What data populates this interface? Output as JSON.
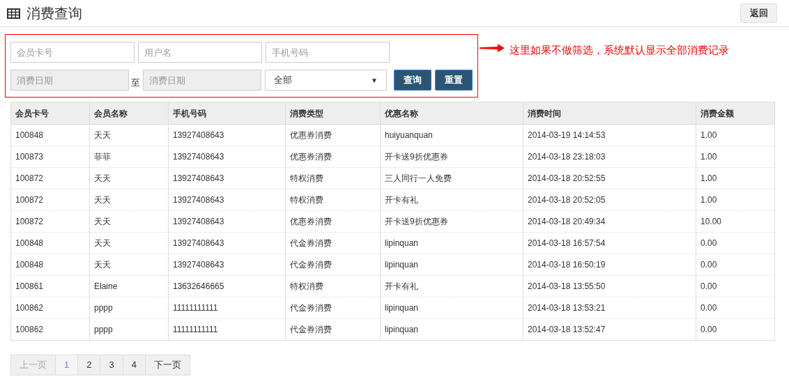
{
  "header": {
    "title": "消费查询",
    "back_button": "返回"
  },
  "filters": {
    "row_1": [
      {
        "placeholder": "会员卡号",
        "disabled": false
      },
      {
        "placeholder": "用户名",
        "disabled": false
      },
      {
        "placeholder": "手机号码",
        "disabled": false
      }
    ],
    "date_from": {
      "placeholder": "消费日期",
      "disabled": true
    },
    "date_separator": "至",
    "date_to": {
      "placeholder": "消费日期",
      "disabled": true
    },
    "type_select": {
      "value": "全部",
      "caret": "▼"
    },
    "buttons": [
      "查询",
      "重置"
    ]
  },
  "annotation": "这里如果不做筛选，系统默认显示全部消费记录",
  "table": {
    "columns": [
      "会员卡号",
      "会员名称",
      "手机号码",
      "消费类型",
      "优惠名称",
      "消费时间",
      "消费金额"
    ],
    "rows": [
      [
        "100848",
        "天天",
        "13927408643",
        "优惠券消费",
        "huiyuanquan",
        "2014-03-19 14:14:53",
        "1.00"
      ],
      [
        "100873",
        "菲菲",
        "13927408643",
        "优惠券消费",
        "开卡送9折优惠券",
        "2014-03-18 23:18:03",
        "1.00"
      ],
      [
        "100872",
        "天天",
        "13927408643",
        "特权消费",
        "三人同行一人免费",
        "2014-03-18 20:52:55",
        "1.00"
      ],
      [
        "100872",
        "天天",
        "13927408643",
        "特权消费",
        "开卡有礼",
        "2014-03-18 20:52:05",
        "1.00"
      ],
      [
        "100872",
        "天天",
        "13927408643",
        "优惠券消费",
        "开卡送9折优惠券",
        "2014-03-18 20:49:34",
        "10.00"
      ],
      [
        "100848",
        "天天",
        "13927408643",
        "代金券消费",
        "lipinquan",
        "2014-03-18 16:57:54",
        "0.00"
      ],
      [
        "100848",
        "天天",
        "13927408643",
        "代金券消费",
        "lipinquan",
        "2014-03-18 16:50:19",
        "0.00"
      ],
      [
        "100861",
        "Elaine",
        "13632646665",
        "特权消费",
        "开卡有礼",
        "2014-03-18 13:55:50",
        "0.00"
      ],
      [
        "100862",
        "pppp",
        "11111111111",
        "代金券消费",
        "lipinquan",
        "2014-03-18 13:53:21",
        "0.00"
      ],
      [
        "100862",
        "pppp",
        "11111111111",
        "代金券消费",
        "lipinquan",
        "2014-03-18 13:52:47",
        "0.00"
      ]
    ]
  },
  "pagination": [
    {
      "label": "上一页",
      "selected": false,
      "disabled": true
    },
    {
      "label": "1",
      "selected": true,
      "disabled": false
    },
    {
      "label": "2",
      "selected": false,
      "disabled": false
    },
    {
      "label": "3",
      "selected": false,
      "disabled": false
    },
    {
      "label": "4",
      "selected": false,
      "disabled": false
    },
    {
      "label": "下一页",
      "selected": false,
      "disabled": false
    }
  ]
}
